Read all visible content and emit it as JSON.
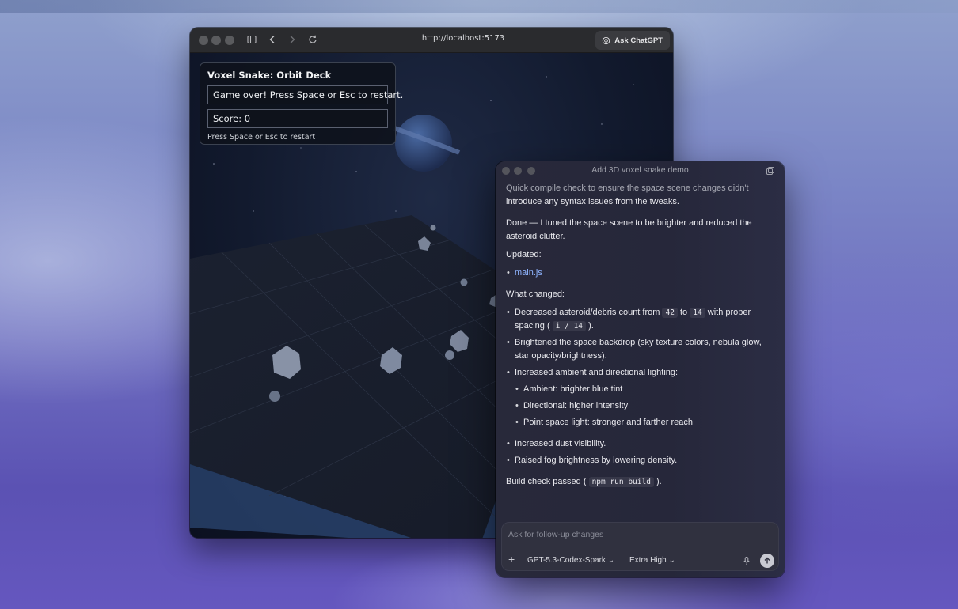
{
  "browser": {
    "url": "http://localhost:5173",
    "ask_label": "Ask ChatGPT"
  },
  "game": {
    "title": "Voxel Snake: Orbit Deck",
    "status": "Game over! Press Space or Esc to restart.",
    "score": "Score: 0",
    "hint": "Press Space or Esc to restart"
  },
  "panel": {
    "title": "Add 3D voxel snake demo",
    "intro_line1": "Quick compile check to ensure the space scene changes didn't",
    "intro_line2": "introduce any syntax issues from the tweaks.",
    "done": "Done — I tuned the space scene to be brighter and reduced the asteroid clutter.",
    "updated_label": "Updated:",
    "file": "main.js",
    "changed_label": "What changed:",
    "c1_pre": "Decreased asteroid/debris count from ",
    "c1_from": "42",
    "c1_mid": " to ",
    "c1_to": "14",
    "c1_post": " with proper spacing ( ",
    "c1_code": "i / 14",
    "c1_end": " ).",
    "c2": "Brightened the space backdrop (sky texture colors, nebula glow, star opacity/brightness).",
    "c3": "Increased ambient and directional lighting:",
    "c3a": "Ambient: brighter blue tint",
    "c3b": "Directional: higher intensity",
    "c3c": "Point space light: stronger and farther reach",
    "c4": "Increased dust visibility.",
    "c5": "Raised fog brightness by lowering density.",
    "build_pre": "Build check passed ( ",
    "build_code": "npm run build",
    "build_post": " ).",
    "composer_placeholder": "Ask for follow-up changes",
    "model": "GPT-5.3-Codex-Spark",
    "effort": "Extra High"
  }
}
